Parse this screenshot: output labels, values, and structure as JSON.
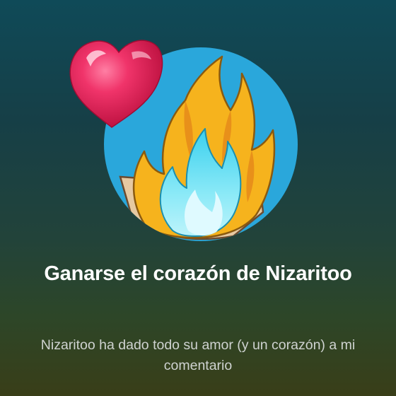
{
  "achievement": {
    "title": "Ganarse el corazón de Nizaritoo",
    "description": "Nizaritoo ha dado todo su amor (y un corazón) a mi comentario"
  },
  "icons": {
    "badge": "fire-badge-icon",
    "heart": "heart-icon"
  },
  "colors": {
    "badge_circle": "#2aa7db",
    "flame_outer": "#f6b31d",
    "flame_inner": "#7de4f5",
    "heart": "#e3194f",
    "title_text": "#ffffff",
    "description_text": "#cfd3d1"
  }
}
